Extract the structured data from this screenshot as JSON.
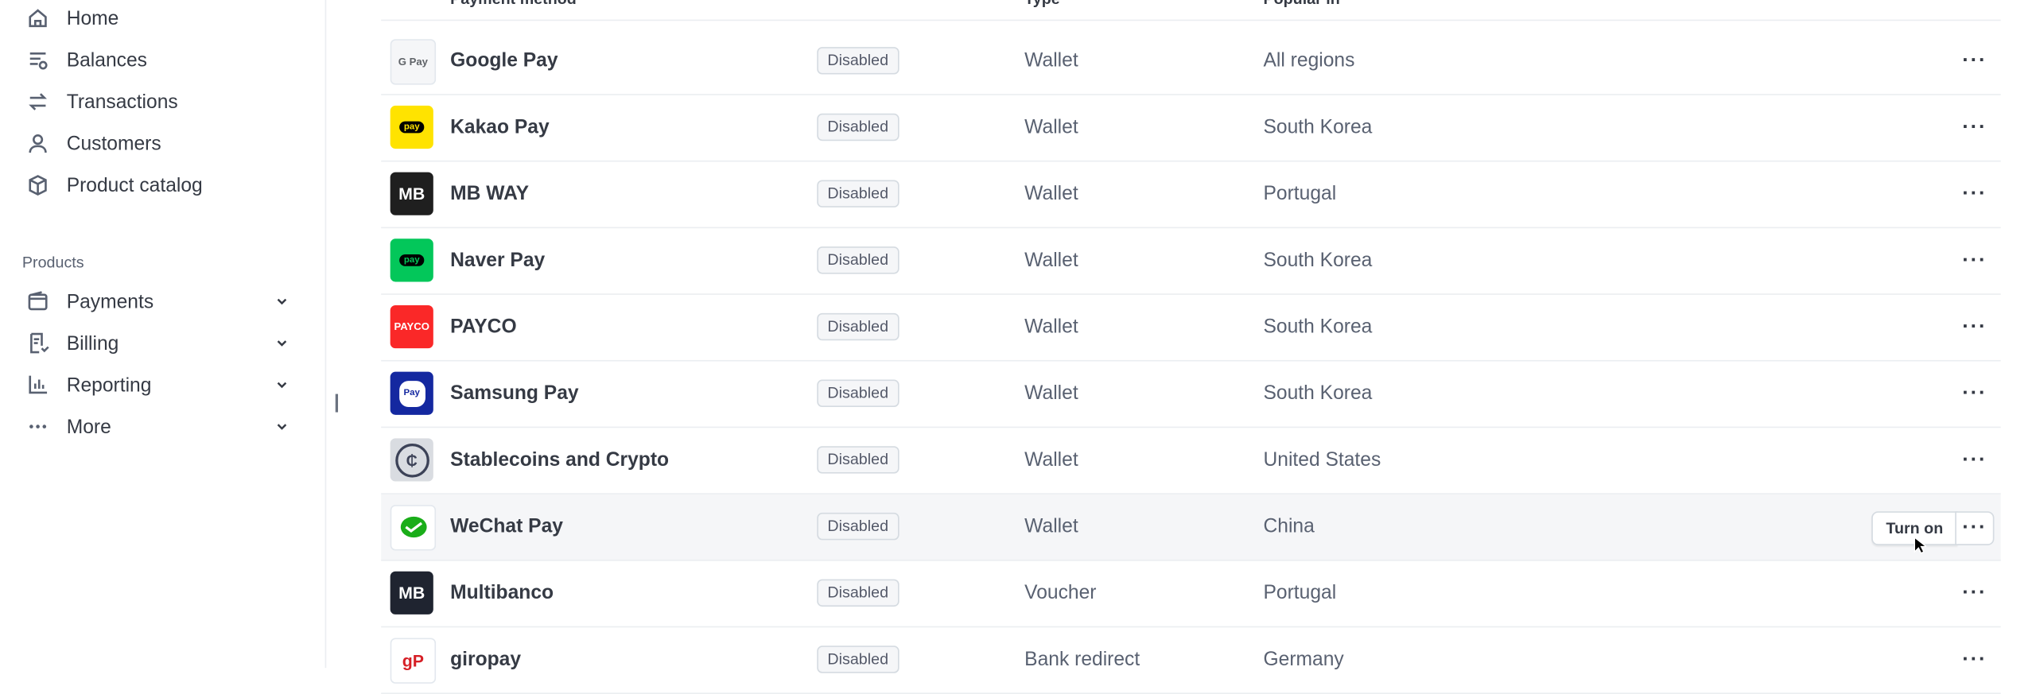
{
  "sidebar": {
    "items": [
      {
        "label": "Home",
        "icon": "home-icon"
      },
      {
        "label": "Balances",
        "icon": "balances-icon"
      },
      {
        "label": "Transactions",
        "icon": "transactions-icon"
      },
      {
        "label": "Customers",
        "icon": "customers-icon"
      },
      {
        "label": "Product catalog",
        "icon": "product-catalog-icon"
      }
    ],
    "section_label": "Products",
    "product_items": [
      {
        "label": "Payments",
        "icon": "payments-icon"
      },
      {
        "label": "Billing",
        "icon": "billing-icon"
      },
      {
        "label": "Reporting",
        "icon": "reporting-icon"
      },
      {
        "label": "More",
        "icon": "more-dots-icon"
      }
    ]
  },
  "table": {
    "headers": {
      "method": "Payment method",
      "type": "Type",
      "popular": "Popular in"
    },
    "rows": [
      {
        "name": "Google Pay",
        "status": "Disabled",
        "type": "Wallet",
        "region": "All regions",
        "logo_text": "G Pay",
        "logo_bg": "#f5f6f8",
        "logo_fg": "#5f6368"
      },
      {
        "name": "Kakao Pay",
        "status": "Disabled",
        "type": "Wallet",
        "region": "South Korea",
        "logo_text": "pay",
        "logo_bg": "#ffe300",
        "logo_fg": "#000000"
      },
      {
        "name": "MB WAY",
        "status": "Disabled",
        "type": "Wallet",
        "region": "Portugal",
        "logo_text": "MB",
        "logo_bg": "#1f1f1f",
        "logo_fg": "#ffffff"
      },
      {
        "name": "Naver Pay",
        "status": "Disabled",
        "type": "Wallet",
        "region": "South Korea",
        "logo_text": "pay",
        "logo_bg": "#03c75a",
        "logo_fg": "#000000"
      },
      {
        "name": "PAYCO",
        "status": "Disabled",
        "type": "Wallet",
        "region": "South Korea",
        "logo_text": "PAYCO",
        "logo_bg": "#fa2828",
        "logo_fg": "#ffffff"
      },
      {
        "name": "Samsung Pay",
        "status": "Disabled",
        "type": "Wallet",
        "region": "South Korea",
        "logo_text": "Pay",
        "logo_bg": "#1428a0",
        "logo_fg": "#1428a0"
      },
      {
        "name": "Stablecoins and Crypto",
        "status": "Disabled",
        "type": "Wallet",
        "region": "United States",
        "logo_text": "₵",
        "logo_bg": "#d9dce1",
        "logo_fg": "#3c4257"
      },
      {
        "name": "WeChat Pay",
        "status": "Disabled",
        "type": "Wallet",
        "region": "China",
        "logo_text": "",
        "logo_bg": "#ffffff",
        "logo_fg": "#1aad19"
      },
      {
        "name": "Multibanco",
        "status": "Disabled",
        "type": "Voucher",
        "region": "Portugal",
        "logo_text": "MB",
        "logo_bg": "#1f2430",
        "logo_fg": "#ffffff"
      },
      {
        "name": "giropay",
        "status": "Disabled",
        "type": "Bank redirect",
        "region": "Germany",
        "logo_text": "gP",
        "logo_bg": "#ffffff",
        "logo_fg": "#d61f26"
      }
    ],
    "hover_action": "Turn on",
    "more_symbol": "···"
  }
}
